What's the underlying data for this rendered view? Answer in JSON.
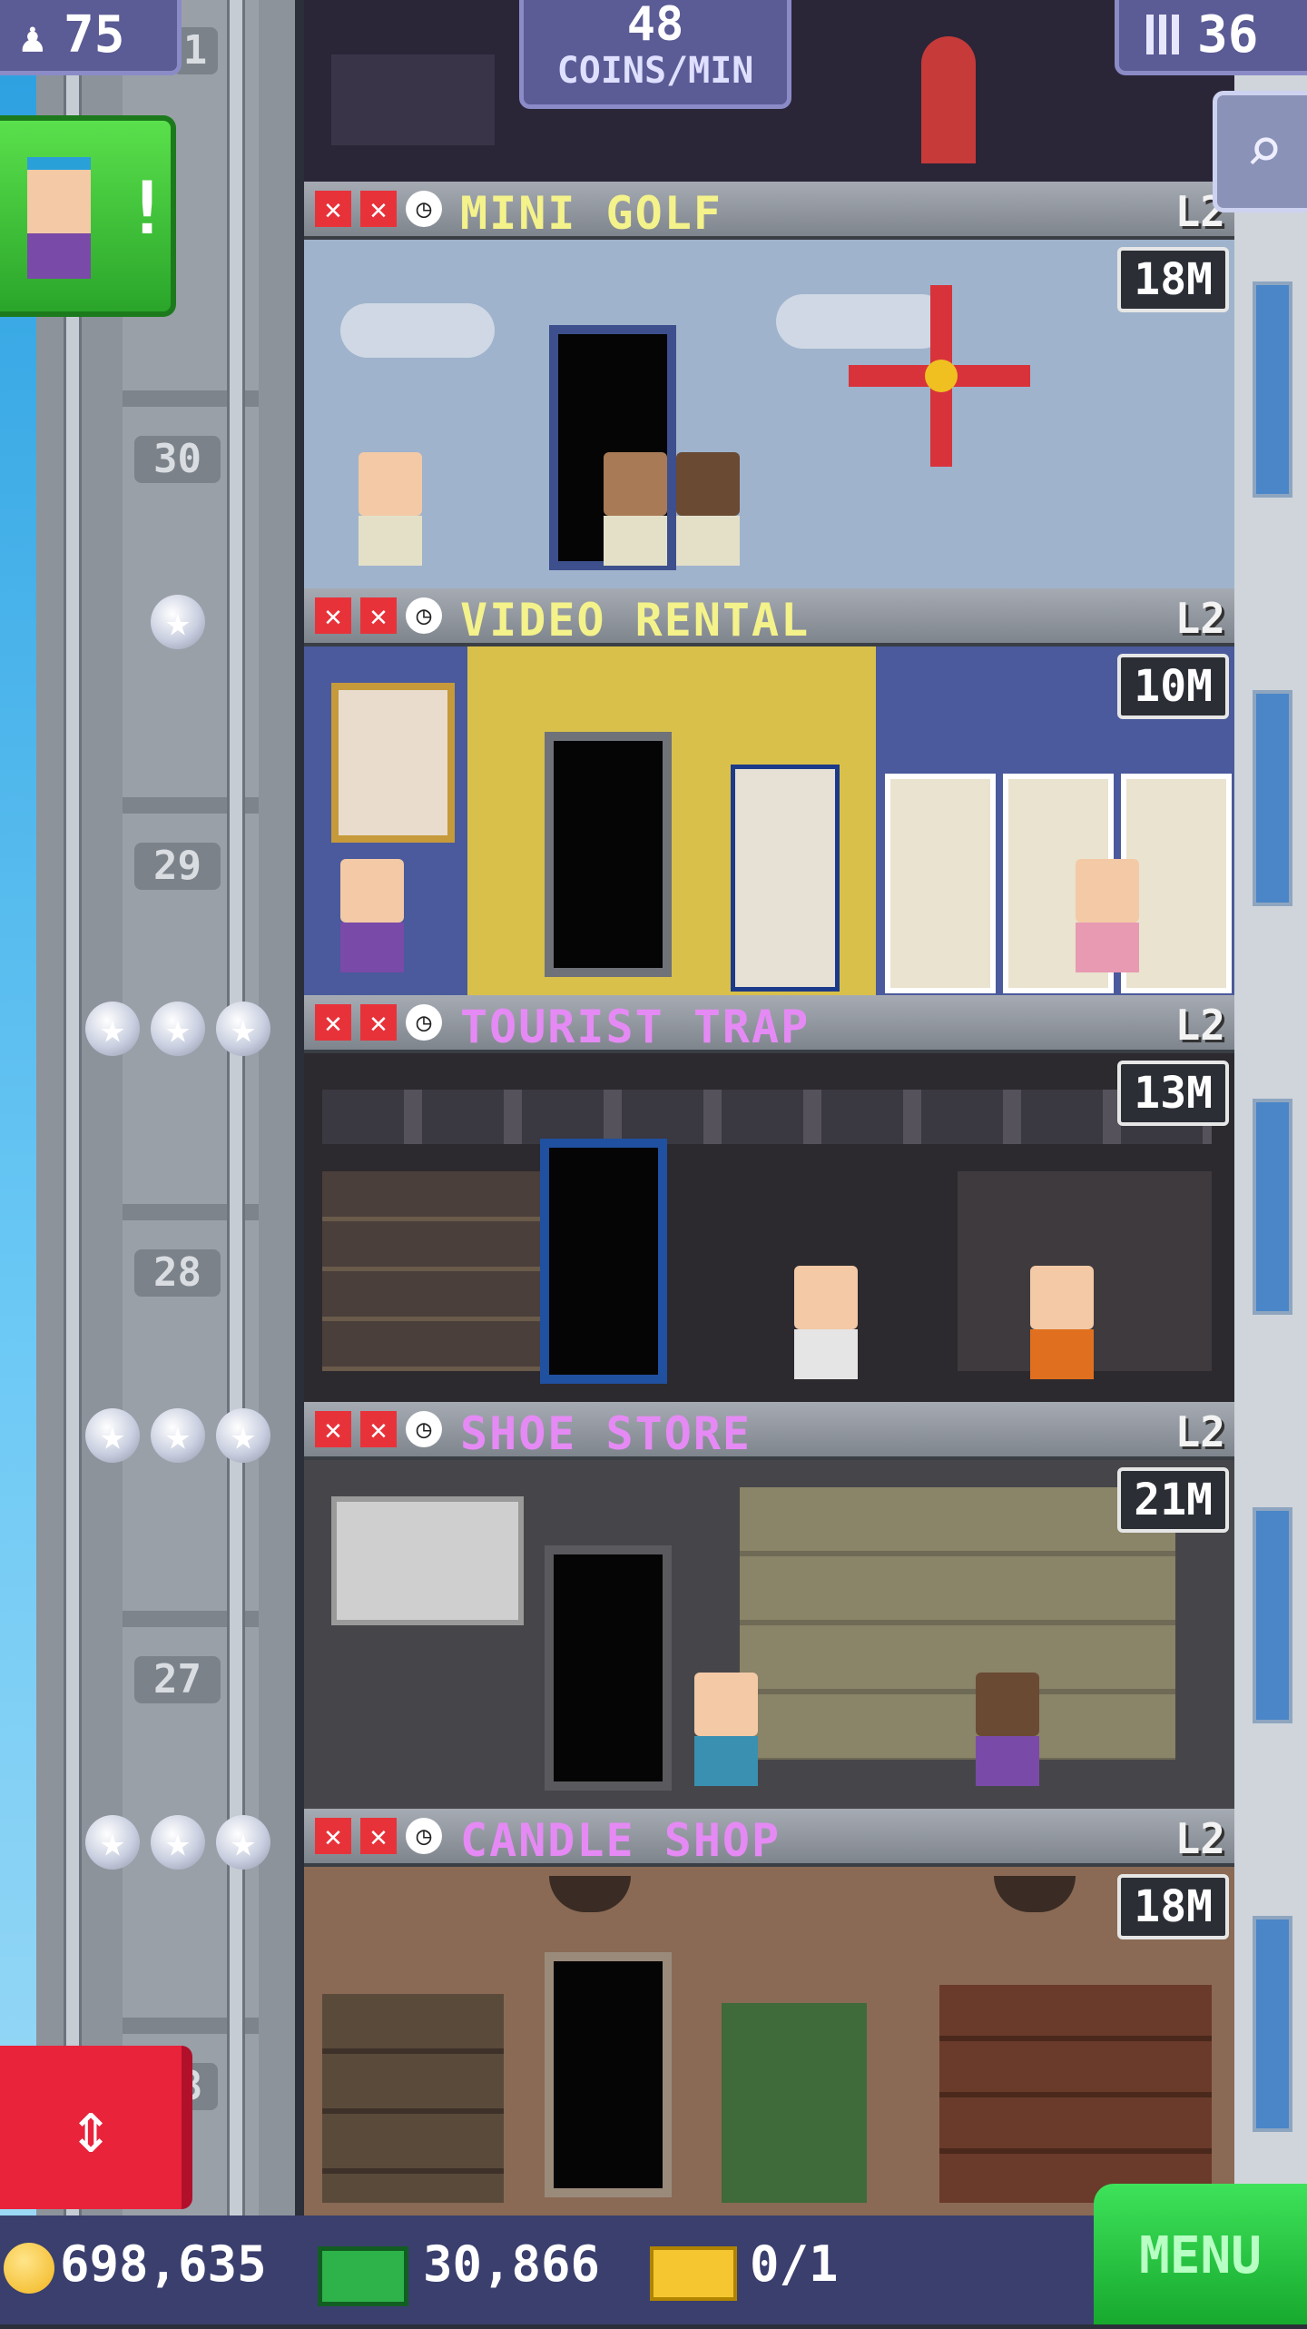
{
  "hud": {
    "population": "75",
    "coins_per_min_value": "48",
    "coins_per_min_label": "COINS/MIN",
    "floors_count": "36",
    "top_floor_partial": "1"
  },
  "floors": [
    {
      "name": "MINI GOLF",
      "level": "L2",
      "timer": "18M",
      "number": "30",
      "stars": 1,
      "name_color": "#f4f28a"
    },
    {
      "name": "VIDEO RENTAL",
      "level": "L2",
      "timer": "10M",
      "number": "29",
      "stars": 3,
      "name_color": "#f4f28a"
    },
    {
      "name": "TOURIST TRAP",
      "level": "L2",
      "timer": "13M",
      "number": "28",
      "stars": 3,
      "name_color": "#e58af4"
    },
    {
      "name": "SHOE STORE",
      "level": "L2",
      "timer": "21M",
      "number": "27",
      "stars": 3,
      "name_color": "#e58af4"
    },
    {
      "name": "CANDLE SHOP",
      "level": "L2",
      "timer": "18M",
      "number": "8",
      "stars": 0,
      "name_color": "#e58af4"
    }
  ],
  "footer": {
    "coins": "698,635",
    "bux": "30,866",
    "tickets": "0/1",
    "menu_label": "MENU"
  },
  "icons": {
    "population": "person-icon",
    "floors": "building-icon",
    "search": "magnifier-icon",
    "elevator": "up-down-arrows-icon",
    "mission": "bitizen-avatar-icon"
  },
  "colors": {
    "accent_green": "#2aa52a",
    "elevator_red": "#e8233a",
    "hud_purple": "#5b5b96"
  }
}
